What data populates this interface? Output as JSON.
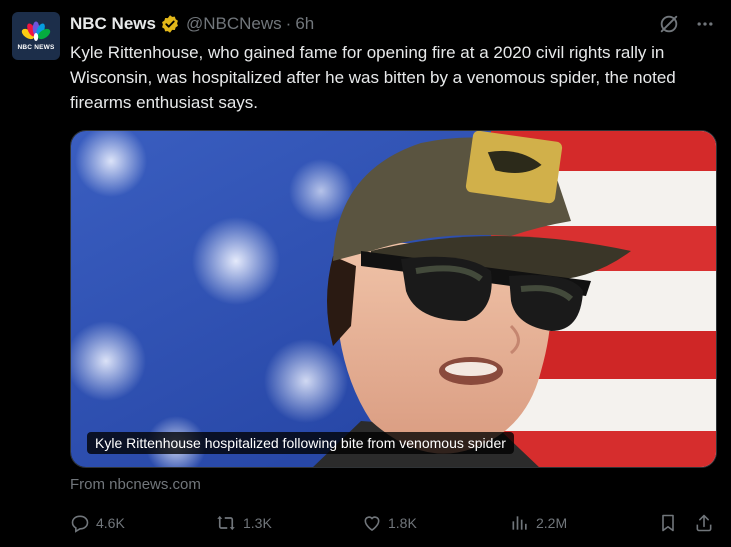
{
  "tweet": {
    "author_name": "NBC News",
    "handle": "@NBCNews",
    "separator": "·",
    "time": "6h",
    "avatar_text": "NBC NEWS",
    "text": "Kyle Rittenhouse, who gained fame for opening fire at a 2020 civil rights rally in Wisconsin, was hospitalized after he was bitten by a venomous spider, the noted firearms enthusiast says."
  },
  "card": {
    "caption": "Kyle Rittenhouse hospitalized following bite from venomous spider",
    "source": "From nbcnews.com"
  },
  "actions": {
    "replies": "4.6K",
    "reposts": "1.3K",
    "likes": "1.8K",
    "views": "2.2M"
  },
  "icons": {
    "verified": "verified-badge-icon",
    "grok": "grok-icon",
    "more": "more-icon",
    "reply": "reply-icon",
    "repost": "repost-icon",
    "like": "heart-icon",
    "views": "views-icon",
    "bookmark": "bookmark-icon",
    "share": "share-icon"
  },
  "colors": {
    "background": "#000000",
    "text": "#e7e9ea",
    "secondary": "#71767b",
    "verified": "#e2b719"
  }
}
